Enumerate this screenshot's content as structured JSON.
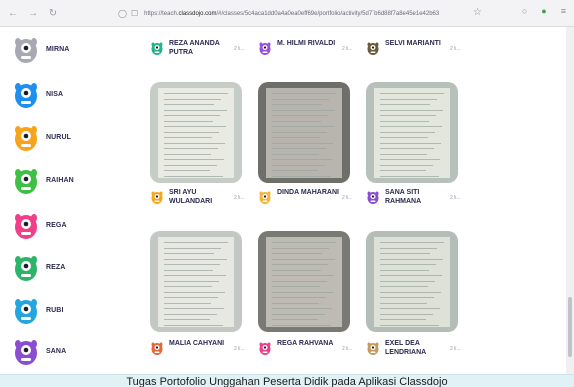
{
  "browser": {
    "url_prefix": "https://teach.",
    "url_domain": "classdojo.com",
    "url_rest": "/#/classes/5c4aca1dd0a4a0ea0eff69e/portfolio/activity/5d7`b6d88f7a8e45e1e42b63",
    "icons": [
      "back-icon",
      "forward-icon",
      "reload-icon",
      "shield-icon",
      "lock-icon",
      "star-icon",
      "pocket-icon",
      "extension-icon",
      "menu-icon"
    ]
  },
  "sidebar": {
    "students": [
      {
        "name": "MIRNA",
        "color": "#a8a8b4"
      },
      {
        "name": "NISA",
        "color": "#1e8ff0"
      },
      {
        "name": "NURUL",
        "color": "#f7a41c"
      },
      {
        "name": "RAIHAN",
        "color": "#3fbf45"
      },
      {
        "name": "REGA",
        "color": "#ef3f88"
      },
      {
        "name": "REZA",
        "color": "#2cb56a"
      },
      {
        "name": "RUBI",
        "color": "#25a5e0"
      },
      {
        "name": "SANA",
        "color": "#8a4fd1"
      }
    ]
  },
  "posts": [
    {
      "name": "REZA ANANDA PUTRA",
      "meta": "2 li...",
      "color": "#22b58a"
    },
    {
      "name": "M. HILMI RIVALDI",
      "meta": "2 li...",
      "color": "#9b4fe0"
    },
    {
      "name": "SELVI MARIANTI",
      "meta": "2 li...",
      "color": "#6b5a3a"
    },
    {
      "name": "SRI AYU WULANDARI",
      "meta": "2 li...",
      "color": "#f6a81d"
    },
    {
      "name": "DINDA MAHARANI",
      "meta": "2 li...",
      "color": "#f3b63a"
    },
    {
      "name": "SANA SITI RAHMANA",
      "meta": "2 li...",
      "color": "#8a4fd1"
    },
    {
      "name": "MALIA CAHYANI",
      "meta": "2 li...",
      "color": "#e8663a"
    },
    {
      "name": "REGA RAHVANA",
      "meta": "2 li...",
      "color": "#ef3f88"
    },
    {
      "name": "EXEL DEA LENDRIANA",
      "meta": "2 li...",
      "color": "#c79a5a"
    }
  ],
  "caption": "Tugas Portofolio Unggahan Peserta Didik pada Aplikasi Classdojo"
}
